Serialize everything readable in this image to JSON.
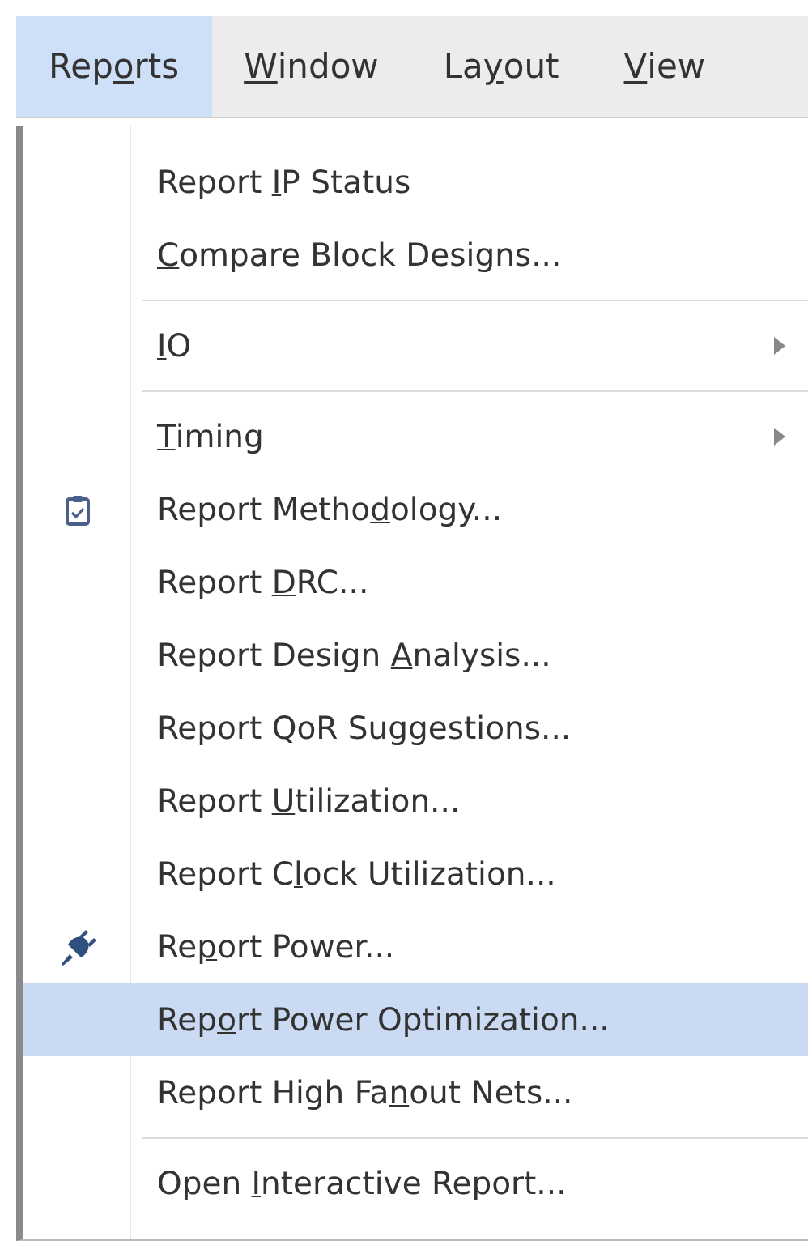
{
  "menubar": [
    {
      "label": {
        "before": "Rep",
        "key": "o",
        "after": "rts"
      },
      "selected": true
    },
    {
      "label": {
        "key": "W",
        "after": "indow"
      },
      "selected": false
    },
    {
      "label": {
        "before": "La",
        "key": "y",
        "after": "out"
      },
      "selected": false
    },
    {
      "label": {
        "key": "V",
        "after": "iew"
      },
      "selected": false
    }
  ],
  "menu": [
    {
      "kind": "item",
      "label": {
        "before": "Report ",
        "key": "I",
        "after": "P Status"
      },
      "selected": false
    },
    {
      "kind": "item",
      "label": {
        "key": "C",
        "after": "ompare Block Designs..."
      },
      "selected": false
    },
    {
      "kind": "separator"
    },
    {
      "kind": "submenu",
      "label": {
        "key": "I",
        "after": "O"
      },
      "selected": false
    },
    {
      "kind": "separator"
    },
    {
      "kind": "submenu",
      "label": {
        "key": "T",
        "after": "iming"
      },
      "selected": false
    },
    {
      "kind": "clipboard",
      "label": {
        "before": "Report Metho",
        "key": "d",
        "after": "ology..."
      },
      "selected": false
    },
    {
      "kind": "item",
      "label": {
        "before": "Report ",
        "key": "D",
        "after": "RC..."
      },
      "selected": false
    },
    {
      "kind": "item",
      "label": {
        "before": "Report Design ",
        "key": "A",
        "after": "nalysis..."
      },
      "selected": false
    },
    {
      "kind": "item",
      "label": {
        "before": "Report QoR Suggestions..."
      },
      "selected": false
    },
    {
      "kind": "item",
      "label": {
        "before": "Report ",
        "key": "U",
        "after": "tilization..."
      },
      "selected": false
    },
    {
      "kind": "item",
      "label": {
        "before": "Report C",
        "key": "l",
        "after": "ock Utilization..."
      },
      "selected": false
    },
    {
      "kind": "plug",
      "label": {
        "before": "Re",
        "key": "p",
        "after": "ort Power..."
      },
      "selected": false
    },
    {
      "kind": "item",
      "label": {
        "before": "Rep",
        "key": "o",
        "after": "rt Power Optimization..."
      },
      "selected": true
    },
    {
      "kind": "item",
      "label": {
        "before": "Report High Fa",
        "key": "n",
        "after": "out Nets..."
      },
      "selected": false
    },
    {
      "kind": "separator"
    },
    {
      "kind": "item",
      "label": {
        "before": "Open ",
        "key": "I",
        "after": "nteractive Report..."
      },
      "selected": false
    }
  ]
}
